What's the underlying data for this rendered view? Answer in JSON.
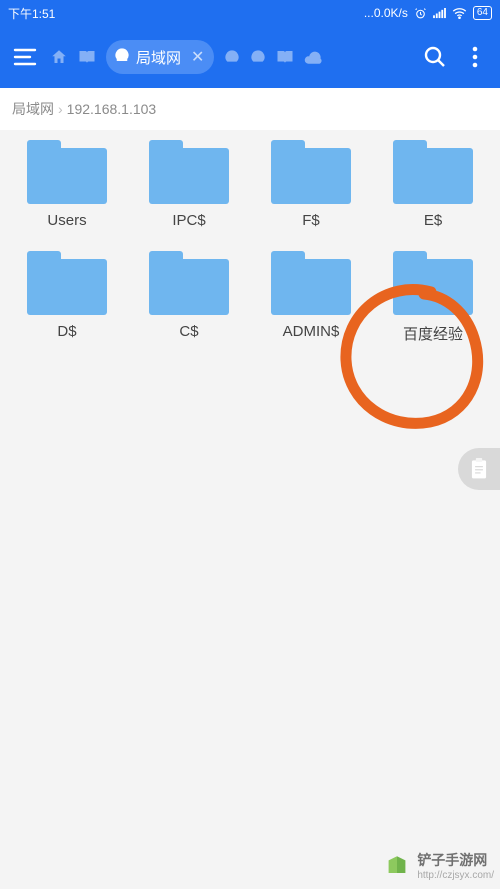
{
  "status": {
    "time": "下午1:51",
    "net_speed": "...0.0K/s",
    "battery": "64"
  },
  "appbar": {
    "active_tab_label": "局域网"
  },
  "breadcrumb": {
    "root": "局域网",
    "path": "192.168.1.103"
  },
  "folders": [
    {
      "name": "Users"
    },
    {
      "name": "IPC$"
    },
    {
      "name": "F$"
    },
    {
      "name": "E$"
    },
    {
      "name": "D$"
    },
    {
      "name": "C$"
    },
    {
      "name": "ADMIN$"
    },
    {
      "name": "百度经验"
    }
  ],
  "watermark": {
    "title": "铲子手游网",
    "url": "http://czjsyx.com/"
  }
}
